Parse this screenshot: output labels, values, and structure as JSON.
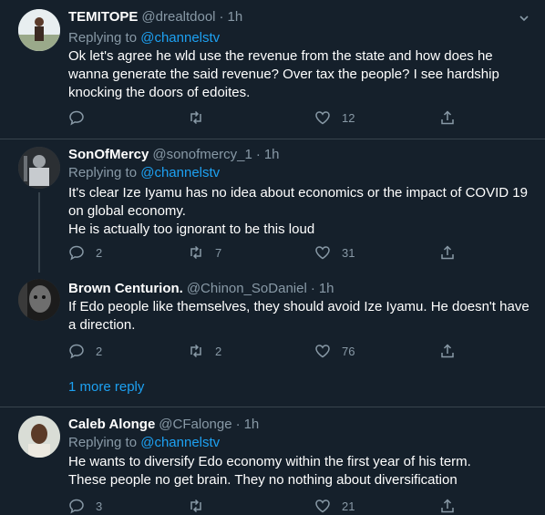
{
  "tweets": [
    {
      "name": "TEMITOPE",
      "handle": "@drealtdool",
      "time": "1h",
      "replying_prefix": "Replying to",
      "replying_to": "@channelstv",
      "lines": [
        "Ok let's agree he wld use the revenue from the state and how does he",
        "wanna generate the said revenue? Over tax the people? I see hardship",
        "knocking the doors of edoites."
      ],
      "replies": "",
      "retweets": "",
      "likes": "12"
    },
    {
      "name": "SonOfMercy",
      "handle": "@sonofmercy_1",
      "time": "1h",
      "replying_prefix": "Replying to",
      "replying_to": "@channelstv",
      "lines": [
        "It's clear Ize Iyamu has no idea about economics or the impact of COVID 19",
        "on global economy.",
        "He is actually too ignorant to be this loud"
      ],
      "replies": "2",
      "retweets": "7",
      "likes": "31"
    },
    {
      "name": "Brown Centurion.",
      "handle": "@Chinon_SoDaniel",
      "time": "1h",
      "lines": [
        "If Edo people like themselves, they should avoid Ize Iyamu. He doesn't have",
        "a direction."
      ],
      "replies": "2",
      "retweets": "2",
      "likes": "76"
    },
    {
      "name": "Caleb Alonge",
      "handle": "@CFalonge",
      "time": "1h",
      "replying_prefix": "Replying to",
      "replying_to": "@channelstv",
      "lines": [
        "He wants to diversify Edo economy within the first year of his term.",
        "These people no get brain. They no nothing about diversification"
      ],
      "replies": "3",
      "retweets": "",
      "likes": "21"
    }
  ],
  "more_replies": "1 more reply",
  "colors": {
    "background": "#15202b",
    "text": "#ffffff",
    "secondary": "#8899a6",
    "accent": "#1da1f2",
    "border": "#38444d"
  },
  "icons": [
    "reply-icon",
    "retweet-icon",
    "like-icon",
    "share-icon",
    "chevron-down-icon"
  ]
}
